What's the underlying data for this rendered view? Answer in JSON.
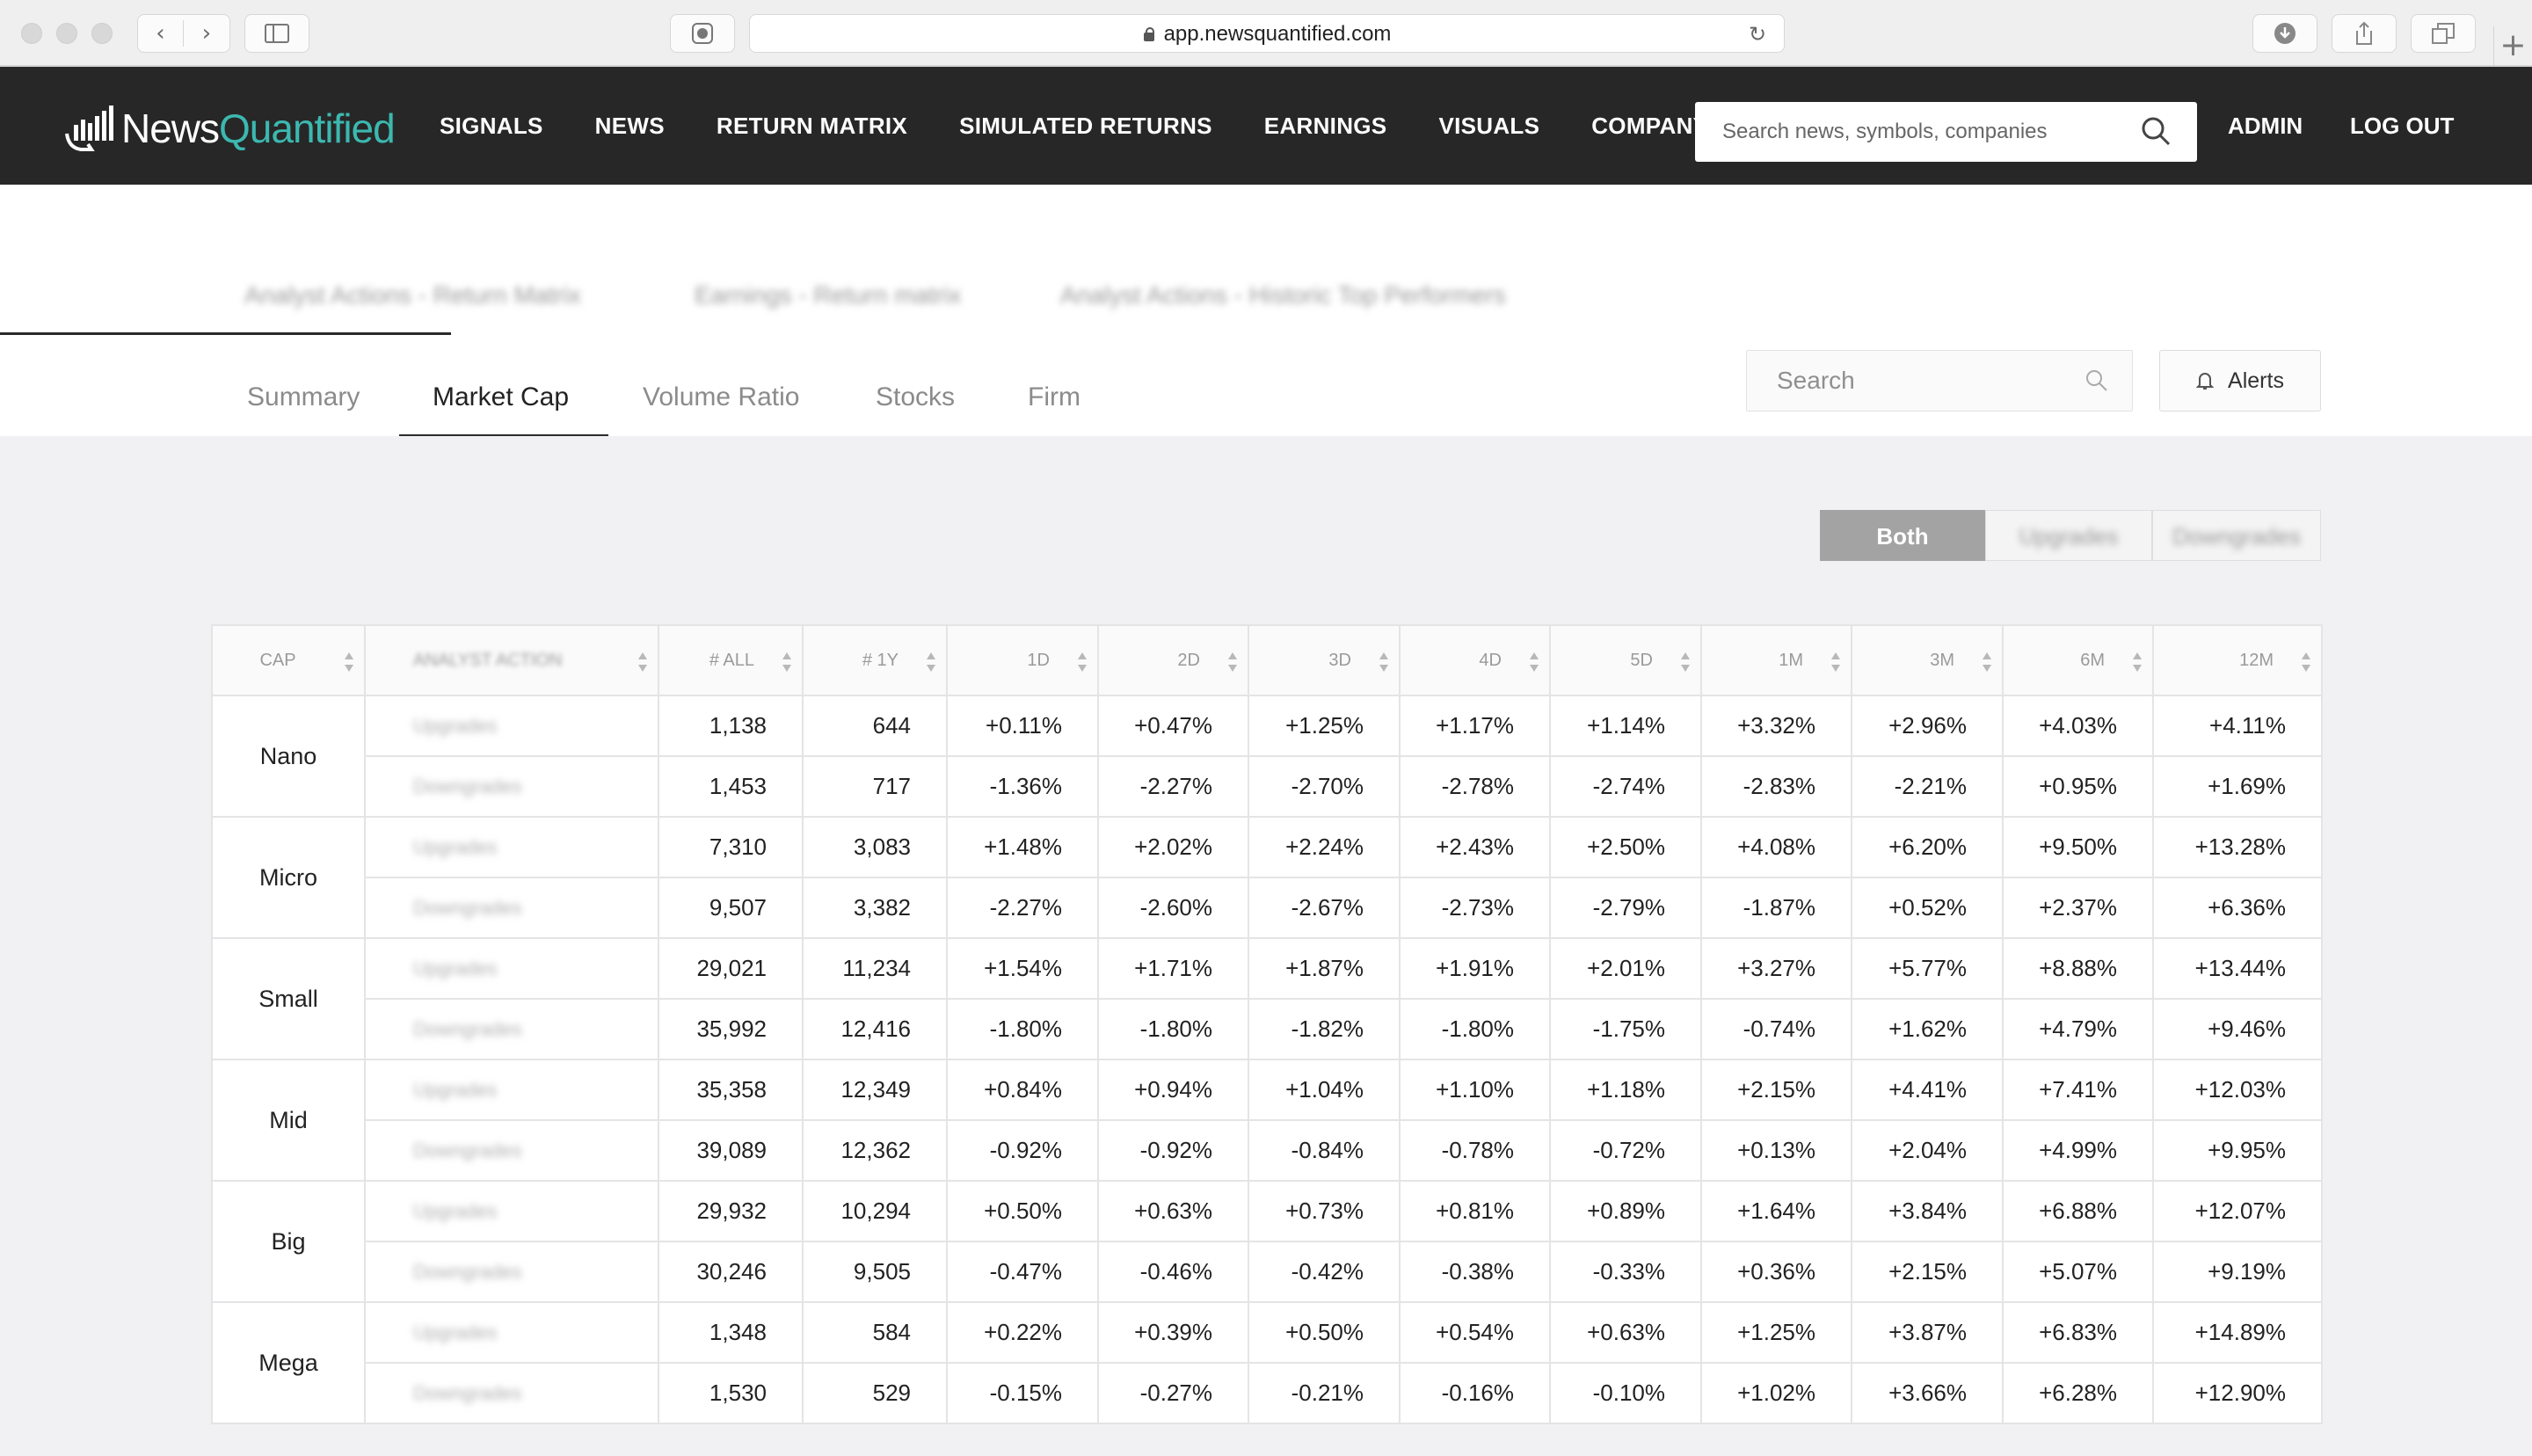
{
  "browser": {
    "url": "app.newsquantified.com"
  },
  "brand": {
    "name_part1": "News",
    "name_part2": "Quantified",
    "accent_color": "#3cb8b0",
    "navbar_color": "#272727"
  },
  "nav": {
    "links": [
      "SIGNALS",
      "NEWS",
      "RETURN MATRIX",
      "SIMULATED RETURNS",
      "EARNINGS",
      "VISUALS",
      "COMPANY"
    ],
    "search_placeholder": "Search news, symbols, companies",
    "admin": "ADMIN",
    "logout": "LOG OUT"
  },
  "top_tabs": [
    "Analyst Actions - Return Matrix",
    "Earnings - Return matrix",
    "Analyst Actions - Historic Top Performers"
  ],
  "sub_tabs": [
    "Summary",
    "Market Cap",
    "Volume Ratio",
    "Stocks",
    "Firm"
  ],
  "active_sub_tab": "Market Cap",
  "search": {
    "placeholder": "Search"
  },
  "alerts_label": "Alerts",
  "toggle": {
    "both": "Both",
    "upgrades": "Upgrades",
    "downgrades": "Downgrades"
  },
  "table": {
    "headers": [
      "CAP",
      "ANALYST ACTION",
      "# ALL",
      "# 1Y",
      "1D",
      "2D",
      "3D",
      "4D",
      "5D",
      "1M",
      "3M",
      "6M",
      "12M"
    ],
    "groups": [
      {
        "cap": "Nano",
        "rows": [
          {
            "action": "Upgrades",
            "values": [
              "1,138",
              "644",
              "+0.11%",
              "+0.47%",
              "+1.25%",
              "+1.17%",
              "+1.14%",
              "+3.32%",
              "+2.96%",
              "+4.03%",
              "+4.11%"
            ]
          },
          {
            "action": "Downgrades",
            "values": [
              "1,453",
              "717",
              "-1.36%",
              "-2.27%",
              "-2.70%",
              "-2.78%",
              "-2.74%",
              "-2.83%",
              "-2.21%",
              "+0.95%",
              "+1.69%"
            ]
          }
        ]
      },
      {
        "cap": "Micro",
        "rows": [
          {
            "action": "Upgrades",
            "values": [
              "7,310",
              "3,083",
              "+1.48%",
              "+2.02%",
              "+2.24%",
              "+2.43%",
              "+2.50%",
              "+4.08%",
              "+6.20%",
              "+9.50%",
              "+13.28%"
            ]
          },
          {
            "action": "Downgrades",
            "values": [
              "9,507",
              "3,382",
              "-2.27%",
              "-2.60%",
              "-2.67%",
              "-2.73%",
              "-2.79%",
              "-1.87%",
              "+0.52%",
              "+2.37%",
              "+6.36%"
            ]
          }
        ]
      },
      {
        "cap": "Small",
        "rows": [
          {
            "action": "Upgrades",
            "values": [
              "29,021",
              "11,234",
              "+1.54%",
              "+1.71%",
              "+1.87%",
              "+1.91%",
              "+2.01%",
              "+3.27%",
              "+5.77%",
              "+8.88%",
              "+13.44%"
            ]
          },
          {
            "action": "Downgrades",
            "values": [
              "35,992",
              "12,416",
              "-1.80%",
              "-1.80%",
              "-1.82%",
              "-1.80%",
              "-1.75%",
              "-0.74%",
              "+1.62%",
              "+4.79%",
              "+9.46%"
            ]
          }
        ]
      },
      {
        "cap": "Mid",
        "rows": [
          {
            "action": "Upgrades",
            "values": [
              "35,358",
              "12,349",
              "+0.84%",
              "+0.94%",
              "+1.04%",
              "+1.10%",
              "+1.18%",
              "+2.15%",
              "+4.41%",
              "+7.41%",
              "+12.03%"
            ]
          },
          {
            "action": "Downgrades",
            "values": [
              "39,089",
              "12,362",
              "-0.92%",
              "-0.92%",
              "-0.84%",
              "-0.78%",
              "-0.72%",
              "+0.13%",
              "+2.04%",
              "+4.99%",
              "+9.95%"
            ]
          }
        ]
      },
      {
        "cap": "Big",
        "rows": [
          {
            "action": "Upgrades",
            "values": [
              "29,932",
              "10,294",
              "+0.50%",
              "+0.63%",
              "+0.73%",
              "+0.81%",
              "+0.89%",
              "+1.64%",
              "+3.84%",
              "+6.88%",
              "+12.07%"
            ]
          },
          {
            "action": "Downgrades",
            "values": [
              "30,246",
              "9,505",
              "-0.47%",
              "-0.46%",
              "-0.42%",
              "-0.38%",
              "-0.33%",
              "+0.36%",
              "+2.15%",
              "+5.07%",
              "+9.19%"
            ]
          }
        ]
      },
      {
        "cap": "Mega",
        "rows": [
          {
            "action": "Upgrades",
            "values": [
              "1,348",
              "584",
              "+0.22%",
              "+0.39%",
              "+0.50%",
              "+0.54%",
              "+0.63%",
              "+1.25%",
              "+3.87%",
              "+6.83%",
              "+14.89%"
            ]
          },
          {
            "action": "Downgrades",
            "values": [
              "1,530",
              "529",
              "-0.15%",
              "-0.27%",
              "-0.21%",
              "-0.16%",
              "-0.10%",
              "+1.02%",
              "+3.66%",
              "+6.28%",
              "+12.90%"
            ]
          }
        ]
      }
    ]
  }
}
